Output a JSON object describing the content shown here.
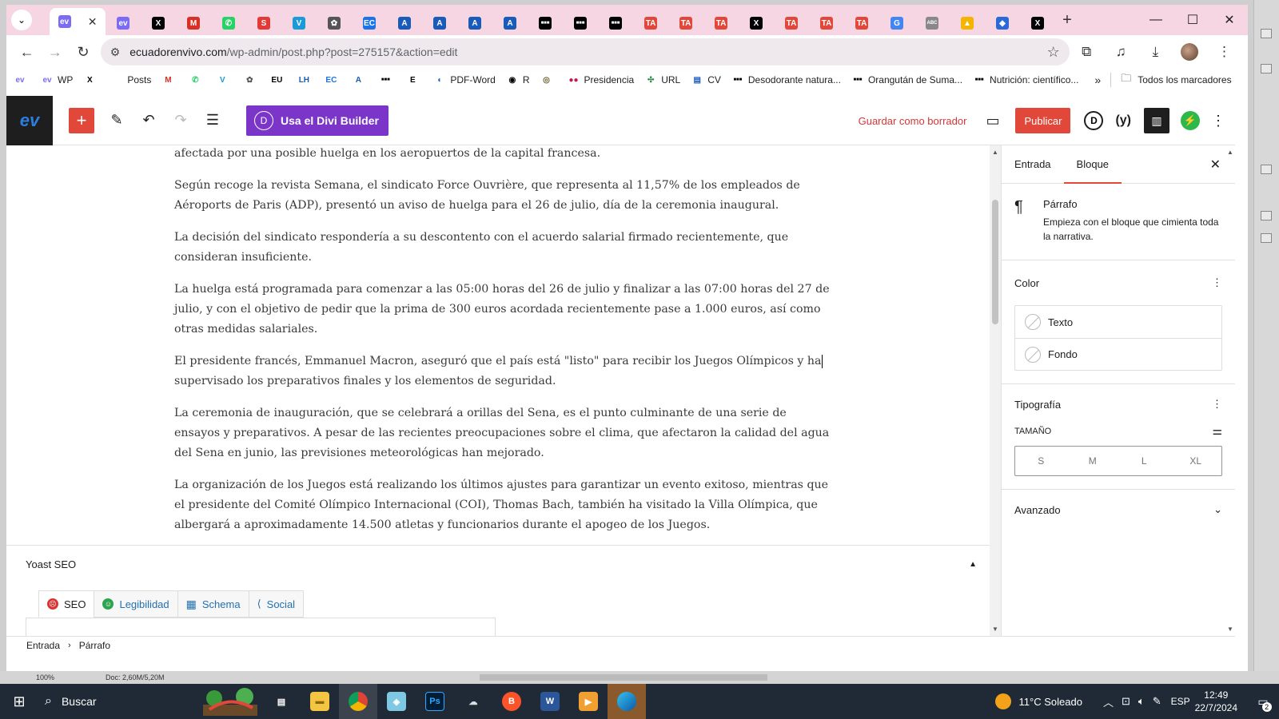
{
  "browser": {
    "tabs": [
      {
        "icon": "ev-icon",
        "color": "#7b6cf6",
        "glyph": "ev"
      },
      {
        "icon": "ev-icon",
        "color": "#7b6cf6",
        "glyph": "ev"
      },
      {
        "icon": "x-icon",
        "color": "#000000",
        "glyph": "X"
      },
      {
        "icon": "gmail-icon",
        "color": "#d93025",
        "glyph": "M"
      },
      {
        "icon": "whatsapp-icon",
        "color": "#25d366",
        "glyph": "✆"
      },
      {
        "icon": "s-icon",
        "color": "#e53935",
        "glyph": "S"
      },
      {
        "icon": "v-icon",
        "color": "#1a9bd7",
        "glyph": "V"
      },
      {
        "icon": "chatgpt-icon",
        "color": "#555555",
        "glyph": "✿"
      },
      {
        "icon": "ec-icon",
        "color": "#1a73e8",
        "glyph": "EC"
      },
      {
        "icon": "a-icon",
        "color": "#1a5ab8",
        "glyph": "A"
      },
      {
        "icon": "a-icon",
        "color": "#1a5ab8",
        "glyph": "A"
      },
      {
        "icon": "a-icon",
        "color": "#1a5ab8",
        "glyph": "A"
      },
      {
        "icon": "a-icon",
        "color": "#1a5ab8",
        "glyph": "A"
      },
      {
        "icon": "dots-icon",
        "color": "#000000",
        "glyph": "■■■"
      },
      {
        "icon": "dots-icon",
        "color": "#000000",
        "glyph": "■■■"
      },
      {
        "icon": "dots-icon",
        "color": "#000000",
        "glyph": "■■■"
      },
      {
        "icon": "ta-icon",
        "color": "#e2483a",
        "glyph": "TA"
      },
      {
        "icon": "ta-icon",
        "color": "#e2483a",
        "glyph": "TA"
      },
      {
        "icon": "ta-icon",
        "color": "#e2483a",
        "glyph": "TA"
      },
      {
        "icon": "x-icon",
        "color": "#000000",
        "glyph": "X"
      },
      {
        "icon": "ta-icon",
        "color": "#e2483a",
        "glyph": "TA"
      },
      {
        "icon": "ta-icon",
        "color": "#e2483a",
        "glyph": "TA"
      },
      {
        "icon": "ta-icon",
        "color": "#e2483a",
        "glyph": "TA"
      },
      {
        "icon": "google-icon",
        "color": "#4285f4",
        "glyph": "G"
      },
      {
        "icon": "abc-icon",
        "color": "#888888",
        "glyph": "ABC"
      },
      {
        "icon": "drive-icon",
        "color": "#f4b400",
        "glyph": "▲"
      },
      {
        "icon": "pin-icon",
        "color": "#2a6ad8",
        "glyph": "◆"
      },
      {
        "icon": "x-icon",
        "color": "#000000",
        "glyph": "X"
      }
    ],
    "url_host": "ecuadorenvivo.com",
    "url_path": "/wp-admin/post.php?post=275157&action=edit",
    "bookmarks": [
      {
        "icon": "ev-icon",
        "label": "",
        "color": "#7b6cf6",
        "glyph": "ev"
      },
      {
        "icon": "ev-icon",
        "label": "WP",
        "color": "#7b6cf6",
        "glyph": "ev"
      },
      {
        "icon": "x-icon",
        "label": "",
        "color": "#000000",
        "glyph": "X"
      },
      {
        "icon": "posts-icon",
        "label": "Posts",
        "color": "#ffffff",
        "glyph": ""
      },
      {
        "icon": "gmail-icon",
        "label": "",
        "color": "#d93025",
        "glyph": "M"
      },
      {
        "icon": "whatsapp-icon",
        "label": "",
        "color": "#25d366",
        "glyph": "✆"
      },
      {
        "icon": "v-icon",
        "label": "",
        "color": "#1a9bd7",
        "glyph": "V"
      },
      {
        "icon": "chatgpt-icon",
        "label": "",
        "color": "#555555",
        "glyph": "✿"
      },
      {
        "icon": "eu-icon",
        "label": "",
        "color": "#000000",
        "glyph": "EU"
      },
      {
        "icon": "lh-icon",
        "label": "",
        "color": "#1a5ab8",
        "glyph": "LH"
      },
      {
        "icon": "ec-icon",
        "label": "",
        "color": "#1a73e8",
        "glyph": "EC"
      },
      {
        "icon": "a-icon",
        "label": "",
        "color": "#1a5ab8",
        "glyph": "A"
      },
      {
        "icon": "dots-icon",
        "label": "",
        "color": "#000000",
        "glyph": "■■■"
      },
      {
        "icon": "e-icon",
        "label": "",
        "color": "#000000",
        "glyph": "E"
      },
      {
        "icon": "pdf-icon",
        "label": "PDF-Word",
        "color": "#1a5ab8",
        "glyph": "◐"
      },
      {
        "icon": "r-icon",
        "label": "R",
        "color": "#000000",
        "glyph": "◉"
      },
      {
        "icon": "seal-icon",
        "label": "",
        "color": "#6b5a2a",
        "glyph": "◎"
      },
      {
        "icon": "presidencia-icon",
        "label": "Presidencia",
        "color": "#c2185b",
        "glyph": "●●"
      },
      {
        "icon": "url-icon",
        "label": "URL",
        "color": "#2a8a4a",
        "glyph": "✣"
      },
      {
        "icon": "cv-icon",
        "label": "CV",
        "color": "#1a5ab8",
        "glyph": "▤"
      },
      {
        "icon": "dots-icon",
        "label": "Desodorante natura...",
        "color": "#000000",
        "glyph": "■■■"
      },
      {
        "icon": "dots-icon",
        "label": "Orangután de Suma...",
        "color": "#000000",
        "glyph": "■■■"
      },
      {
        "icon": "dots-icon",
        "label": "Nutrición: científico...",
        "color": "#000000",
        "glyph": "■■■"
      }
    ],
    "all_bookmarks": "Todos los marcadores"
  },
  "editor": {
    "divi_button": "Usa el Divi Builder",
    "save_draft": "Guardar como borrador",
    "publish": "Publicar",
    "paragraphs": [
      "afectada por una posible huelga en los aeropuertos de la capital francesa.",
      "Según recoge la revista Semana, el sindicato Force Ouvrière, que representa al 11,57% de los empleados de Aéroports de Paris (ADP), presentó un aviso de huelga para el 26 de julio, día de la ceremonia inaugural.",
      "La decisión del sindicato respondería a su descontento con el acuerdo salarial firmado recientemente, que consideran insuficiente.",
      "La huelga está programada para comenzar a las 05:00 horas del 26 de julio y finalizar a las 07:00 horas del 27 de julio, y con el objetivo de pedir que la prima de 300 euros acordada recientemente pase a 1.000 euros, así como otras medidas salariales.",
      "El presidente francés, Emmanuel Macron, aseguró que el país está \"listo\" para recibir los Juegos Olímpicos y ha supervisado los preparativos finales y los elementos de seguridad.",
      "La ceremonia de inauguración, que se celebrará a orillas del Sena, es el punto culminante de una serie de ensayos y preparativos. A pesar de las recientes preocupaciones sobre el clima, que afectaron la calidad del agua del Sena en junio, las previsiones meteorológicas han mejorado.",
      "La organización de los Juegos está realizando los últimos ajustes para garantizar un evento exitoso, mientras que el presidente del Comité Olímpico Internacional (COI), Thomas Bach, también ha visitado la Villa Olímpica, que albergará a aproximadamente 14.500 atletas y funcionarios durante el apogeo de los Juegos."
    ],
    "yoast": {
      "title": "Yoast SEO",
      "tabs": [
        "SEO",
        "Legibilidad",
        "Schema",
        "Social"
      ]
    },
    "breadcrumb": [
      "Entrada",
      "Párrafo"
    ]
  },
  "panel": {
    "tabs": [
      "Entrada",
      "Bloque"
    ],
    "block_title": "Párrafo",
    "block_desc": "Empieza con el bloque que cimienta toda la narrativa.",
    "color_title": "Color",
    "color_rows": [
      "Texto",
      "Fondo"
    ],
    "typography_title": "Tipografía",
    "size_label": "TAMAÑO",
    "sizes": [
      "S",
      "M",
      "L",
      "XL"
    ],
    "advanced_title": "Avanzado"
  },
  "statusbar": {
    "zoom": "100%",
    "doc": "Doc: 2,60M/5,20M"
  },
  "taskbar": {
    "search": "Buscar",
    "weather": "11°C  Soleado",
    "lang": "ESP",
    "time": "12:49",
    "date": "22/7/2024",
    "notifications": "2"
  },
  "colors": {
    "accent": "#e2483a",
    "divi": "#7b35c9",
    "tabbar": "#f6d6e3"
  }
}
